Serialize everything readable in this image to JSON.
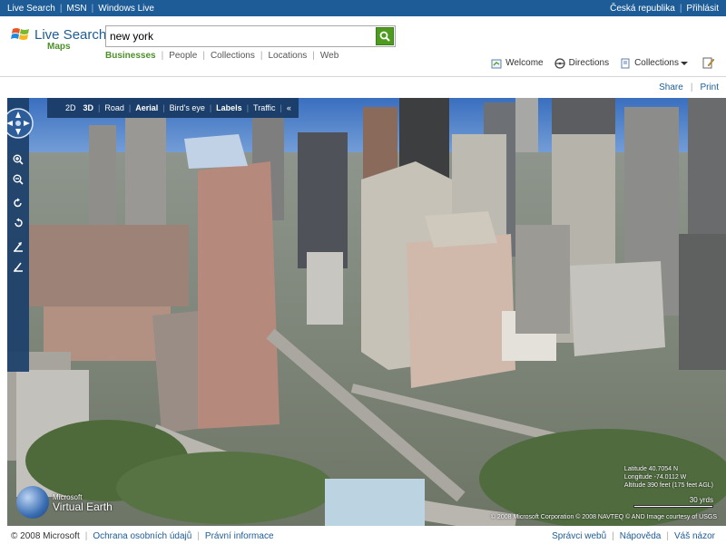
{
  "topbar": {
    "links_left": [
      "Live Search",
      "MSN",
      "Windows Live"
    ],
    "links_right": [
      "Česká republika",
      "Přihlásit"
    ],
    "color": "#1d5c96"
  },
  "logo": {
    "brand": "Live Search",
    "product": "Maps"
  },
  "search": {
    "value": "new york",
    "button_icon": "search-icon",
    "accent": "#4d9b1f"
  },
  "scopes": [
    {
      "label": "Businesses",
      "active": true
    },
    {
      "label": "People",
      "active": false
    },
    {
      "label": "Collections",
      "active": false
    },
    {
      "label": "Locations",
      "active": false
    },
    {
      "label": "Web",
      "active": false
    }
  ],
  "toolbar": {
    "welcome": "Welcome",
    "directions": "Directions",
    "collections": "Collections"
  },
  "share": {
    "share": "Share",
    "print": "Print"
  },
  "map": {
    "modes": [
      "2D",
      "3D",
      "Road",
      "Aerial",
      "Bird's eye",
      "Labels",
      "Traffic"
    ],
    "active_modes": [
      "3D",
      "Aerial",
      "Labels"
    ],
    "collapse": "«",
    "compass_label": "N",
    "nav_icons": [
      "compass-icon",
      "zoom-in-icon",
      "zoom-out-icon",
      "rotate-right-icon",
      "rotate-left-icon",
      "tilt-up-icon",
      "tilt-down-icon"
    ],
    "virtual_earth": {
      "microsoft": "Microsoft",
      "name": "Virtual Earth"
    },
    "coords": {
      "latitude": "Latitude 40.7054 N",
      "longitude": "Longitude -74.0112 W",
      "altitude": "Altitude 390 feet (175 feet AGL)"
    },
    "scale": "30 yrds",
    "copyright": "© 2008 Microsoft Corporation  © 2008 NAVTEQ  © AND  Image courtesy of USGS"
  },
  "footer": {
    "left": [
      "© 2008 Microsoft",
      "Ochrana osobních údajů",
      "Právní informace"
    ],
    "right": [
      "Správci webů",
      "Nápověda",
      "Váš názor"
    ]
  }
}
